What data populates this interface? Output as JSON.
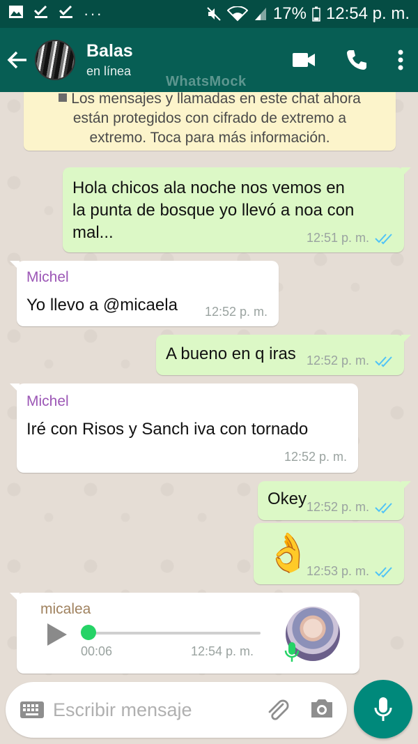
{
  "status_bar": {
    "left_icons": [
      "image-icon",
      "check-icon",
      "check-icon",
      "more-icon"
    ],
    "battery": "17%",
    "time": "12:54 p. m."
  },
  "header": {
    "title": "Balas",
    "subtitle": "en línea",
    "watermark": "WhatsMock",
    "icons": [
      "back-arrow-icon",
      "video-call-icon",
      "phone-icon",
      "more-vert-icon"
    ]
  },
  "notice": {
    "line1": "Los mensajes y llamadas en este chat ahora",
    "line2": "están protegidos con cifrado de extremo a",
    "line3": "extremo. Toca para más información."
  },
  "messages": [
    {
      "direction": "out",
      "lines": [
        "Hola chicos ala noche nos vemos en",
        "la punta de bosque yo llevó a noa con",
        "mal..."
      ],
      "time": "12:51 p. m.",
      "status": "read"
    },
    {
      "direction": "in",
      "sender": "Michel",
      "text": "Yo llevo a @micaela",
      "time": "12:52 p. m."
    },
    {
      "direction": "out",
      "text": "A bueno en q iras",
      "time": "12:52 p. m.",
      "status": "read"
    },
    {
      "direction": "in",
      "sender": "Michel",
      "text": "Iré con  Risos y  Sanch iva con tornado",
      "time": "12:52 p. m."
    },
    {
      "direction": "out",
      "text": "Okey",
      "time": "12:52 p. m.",
      "status": "read"
    },
    {
      "direction": "out",
      "emoji": "👌",
      "time": "12:53 p. m.",
      "status": "read"
    },
    {
      "direction": "in",
      "type": "voice",
      "sender": "micalea",
      "duration": "00:06",
      "time": "12:54 p. m.",
      "progress": 0
    }
  ],
  "input": {
    "placeholder": "Escribir mensaje"
  },
  "colors": {
    "header": "#075e54",
    "status_bar": "#054d44",
    "outgoing_bubble": "#dcf8c6",
    "incoming_bubble": "#ffffff",
    "read_ticks": "#4fc3f7",
    "sender_name": "#9c57b6",
    "fab": "#00897b"
  }
}
